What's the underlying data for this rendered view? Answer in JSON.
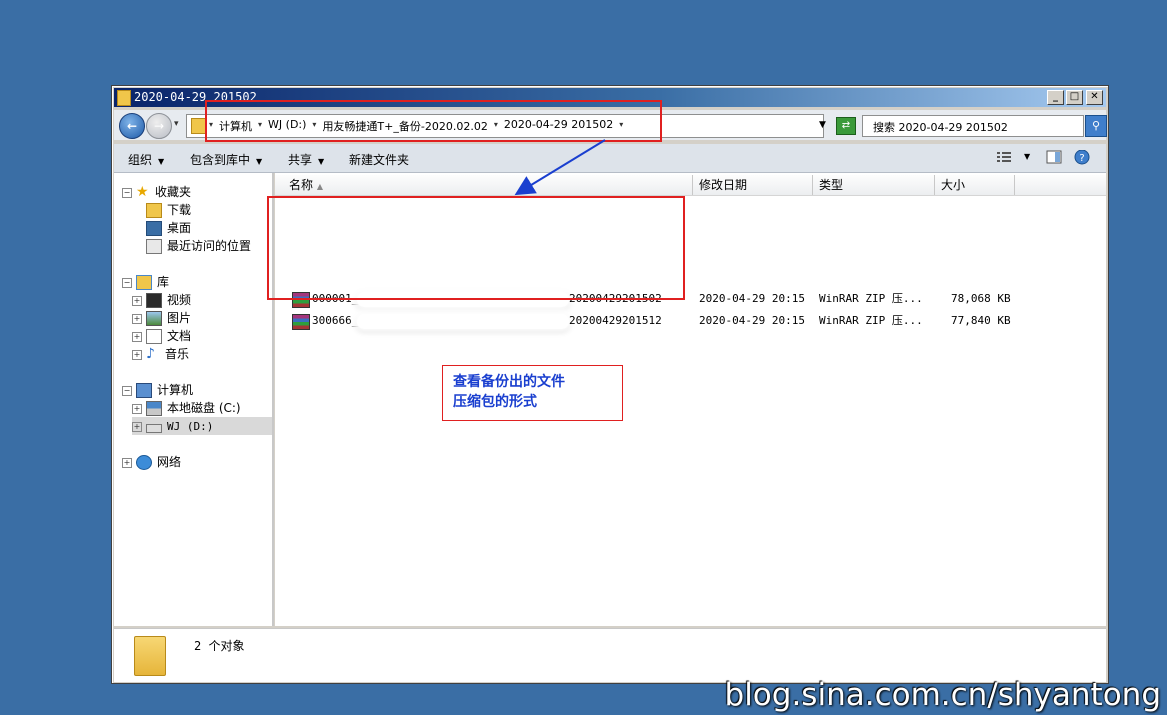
{
  "window": {
    "title": "2020-04-29 201502"
  },
  "address": {
    "crumbs": [
      "计算机",
      "WJ (D:)",
      "用友畅捷通T+_备份-2020.02.02",
      "2020-04-29 201502"
    ],
    "search_placeholder": "搜索 2020-04-29 201502"
  },
  "toolbar": {
    "organize": "组织",
    "include_library": "包含到库中",
    "share": "共享",
    "new_folder": "新建文件夹"
  },
  "nav": {
    "favorites": "收藏夹",
    "downloads": "下载",
    "desktop": "桌面",
    "recent": "最近访问的位置",
    "libraries": "库",
    "videos": "视频",
    "pictures": "图片",
    "documents": "文档",
    "music": "音乐",
    "computer": "计算机",
    "local_disk": "本地磁盘 (C:)",
    "wj_drive": "WJ (D:)",
    "network": "网络"
  },
  "columns": {
    "name": "名称",
    "modified": "修改日期",
    "type": "类型",
    "size": "大小"
  },
  "files": [
    {
      "name_prefix": "000001_",
      "name_suffix": "20200429201502",
      "modified": "2020-04-29 20:15",
      "type": "WinRAR ZIP 压...",
      "size": "78,068 KB"
    },
    {
      "name_prefix": "300666_",
      "name_suffix": "20200429201512",
      "modified": "2020-04-29 20:15",
      "type": "WinRAR ZIP 压...",
      "size": "77,840 KB"
    }
  ],
  "annotation": {
    "line1": "查看备份出的文件",
    "line2": "压缩包的形式"
  },
  "status": {
    "count": "2 个对象"
  },
  "watermark": "blog.sina.com.cn/shyantong",
  "colors": {
    "desktop": "#3a6ea5",
    "highlight": "#e02020",
    "arrow": "#1a3fcf"
  }
}
